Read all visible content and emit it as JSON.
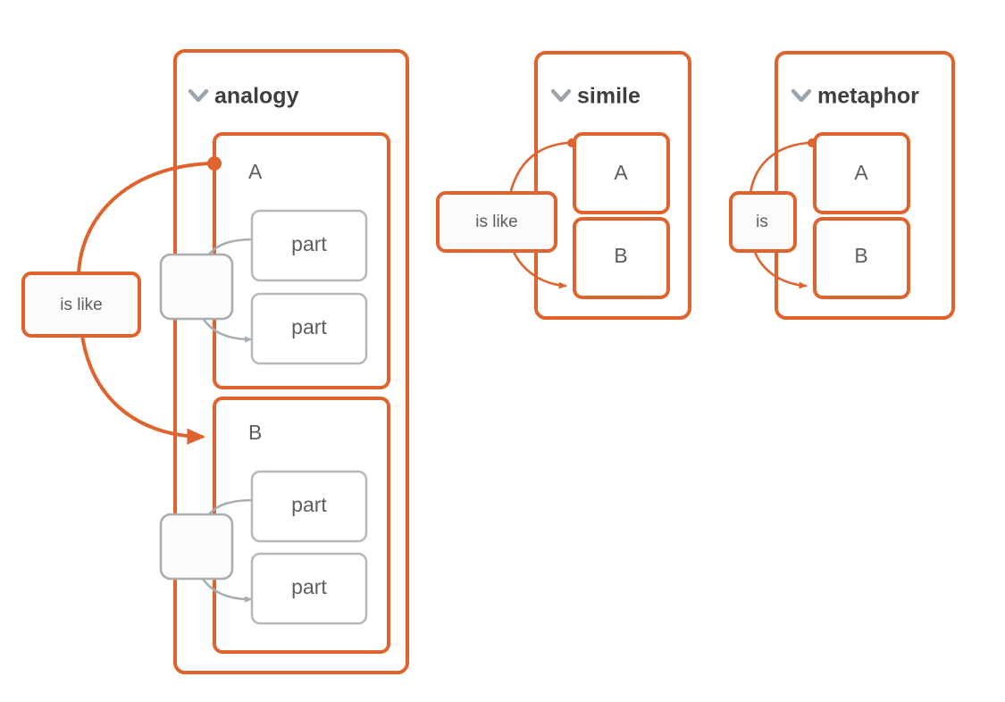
{
  "diagram": {
    "background": "#ffffff",
    "accent_color": "#e0622c",
    "gray_color": "#a8adb2",
    "text_color": "#5a5e62",
    "title_color": "#3d4043",
    "chevron_color": "#9aa5ad",
    "node_fill": "#fcfbf9"
  },
  "panels": [
    {
      "id": "analogy",
      "title": "analogy",
      "chevron": "chevron-down-icon",
      "edge_label": "is like",
      "groups": [
        {
          "id": "analogy-a",
          "label": "A",
          "connector": "",
          "parts": [
            "part",
            "part"
          ]
        },
        {
          "id": "analogy-b",
          "label": "B",
          "connector": "",
          "parts": [
            "part",
            "part"
          ]
        }
      ]
    },
    {
      "id": "simile",
      "title": "simile",
      "chevron": "chevron-down-icon",
      "edge_label": "is like",
      "nodes": [
        "A",
        "B"
      ]
    },
    {
      "id": "metaphor",
      "title": "metaphor",
      "chevron": "chevron-down-icon",
      "edge_label": "is",
      "nodes": [
        "A",
        "B"
      ]
    }
  ]
}
